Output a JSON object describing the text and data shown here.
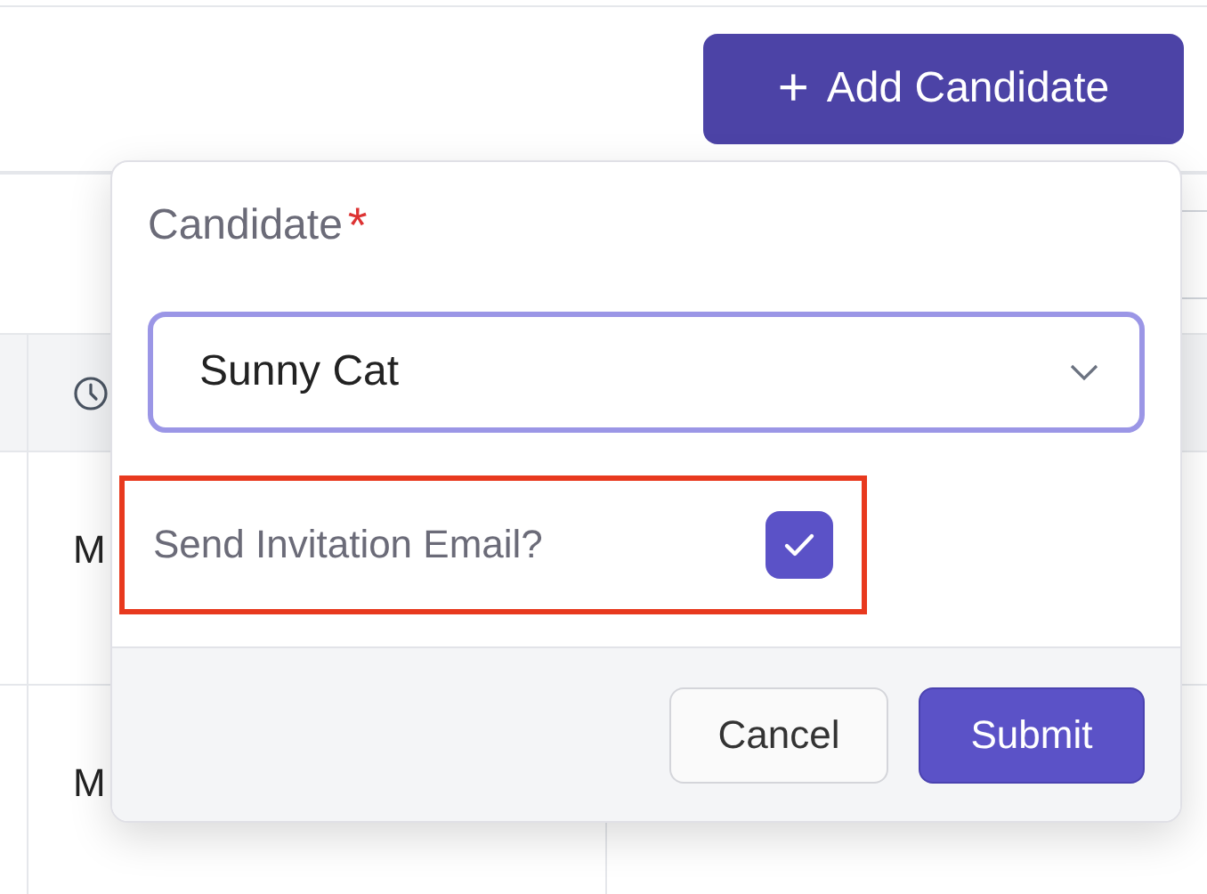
{
  "header": {
    "add_button": {
      "icon": "+",
      "label": "Add Candidate"
    }
  },
  "table": {
    "rows": [
      {
        "cells": [
          "M"
        ]
      },
      {
        "cells": [
          "M"
        ]
      }
    ]
  },
  "popup": {
    "field": {
      "label": "Candidate",
      "required_mark": "*",
      "value": "Sunny Cat"
    },
    "invite": {
      "label": "Send Invitation Email?",
      "checked": true,
      "highlighted": true
    },
    "buttons": [
      {
        "label": "Cancel",
        "kind": "secondary"
      },
      {
        "label": "Submit",
        "kind": "primary"
      }
    ]
  }
}
